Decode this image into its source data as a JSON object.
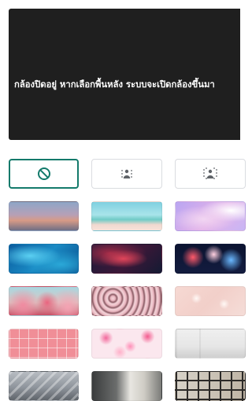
{
  "preview": {
    "message": "กล้องปิดอยู่ หากเลือกพื้นหลัง ระบบจะเปิดกล้องขึ้นมา"
  },
  "colors": {
    "preview_bg": "#1f1f1f",
    "selected_border": "#137a6b",
    "tile_border": "#dadce0"
  },
  "effects": [
    {
      "icon": "no-effect-icon",
      "selected": true
    },
    {
      "icon": "slight-blur-icon",
      "selected": false
    },
    {
      "icon": "blur-icon",
      "selected": false
    }
  ],
  "backgrounds": [
    {
      "row": 1,
      "items": [
        "sunset-sky",
        "tropical-beach",
        "pink-clouds"
      ]
    },
    {
      "row": 2,
      "items": [
        "blue-water",
        "red-nebula",
        "fireworks"
      ]
    },
    {
      "row": 3,
      "items": [
        "pink-flowers",
        "cherry-blossoms",
        "pink-sparkles"
      ]
    },
    {
      "row": 4,
      "items": [
        "pink-grid",
        "pink-confetti",
        "white-gallery"
      ]
    },
    {
      "row": 5,
      "items": [
        "industrial-loft",
        "living-room",
        "bookshelf-room"
      ]
    }
  ]
}
